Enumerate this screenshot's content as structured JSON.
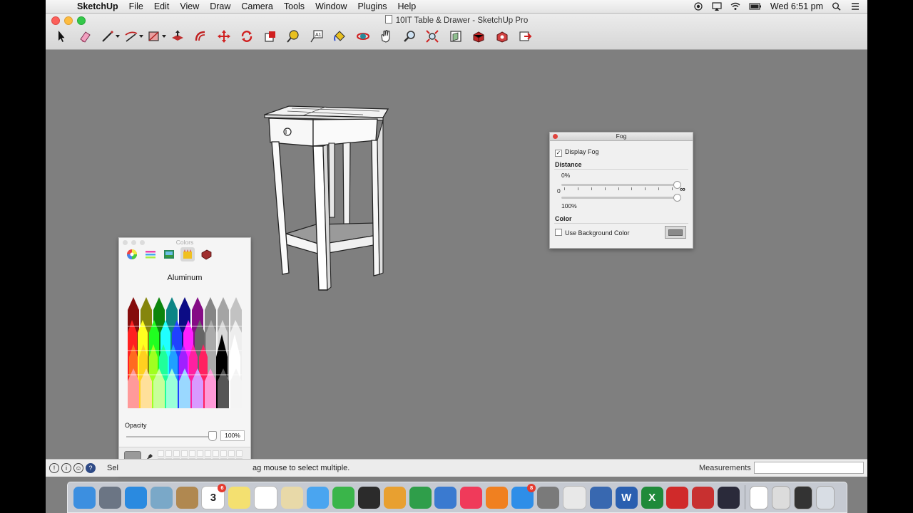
{
  "menubar": {
    "apple": "",
    "items": [
      "SketchUp",
      "File",
      "Edit",
      "View",
      "Draw",
      "Camera",
      "Tools",
      "Window",
      "Plugins",
      "Help"
    ],
    "clock": "Wed 6:51 pm"
  },
  "window": {
    "title": "10IT Table & Drawer - SketchUp Pro"
  },
  "toolbar": {
    "tools": [
      "select-tool",
      "eraser-tool",
      "line-tool",
      "arc-tool",
      "shapes-tool",
      "push-pull-tool",
      "offset-tool",
      "move-tool",
      "rotate-tool",
      "scale-tool",
      "tape-measure-tool",
      "text-tool",
      "paint-bucket-tool",
      "orbit-tool",
      "pan-tool",
      "zoom-tool",
      "zoom-extents-tool",
      "previous-view-tool",
      "warehouse-tool",
      "extension-warehouse-tool",
      "layout-tool"
    ]
  },
  "fog_panel": {
    "title": "Fog",
    "display_fog_label": "Display Fog",
    "display_fog_checked": true,
    "distance_label": "Distance",
    "start_value": "0%",
    "slider_min": "0",
    "slider_max": "∞",
    "end_value": "100%",
    "color_label": "Color",
    "use_bg_label": "Use Background Color",
    "use_bg_checked": false,
    "fog_color": "#8a8a8a"
  },
  "colors_panel": {
    "title": "Colors",
    "tabs": [
      "color-wheel",
      "color-sliders",
      "color-palettes",
      "image-palettes",
      "crayons"
    ],
    "selected_tab": "crayons",
    "crayon_name": "Aluminum",
    "opacity_label": "Opacity",
    "opacity_value": "100%",
    "opacity_fraction": 1.0,
    "current_color": "#9a9a9a"
  },
  "statusbar": {
    "text_left": "Sel",
    "text_right": "ag mouse to select multiple.",
    "measurements_label": "Measurements",
    "measurements_value": ""
  },
  "dock": {
    "apps": [
      {
        "name": "finder",
        "color": "#3c8fe0"
      },
      {
        "name": "launchpad",
        "color": "#6b7584"
      },
      {
        "name": "safari",
        "color": "#2a8ae0"
      },
      {
        "name": "preview",
        "color": "#7aa8c8"
      },
      {
        "name": "contacts",
        "color": "#b08850"
      },
      {
        "name": "calendar",
        "color": "#ffffff",
        "label": "3",
        "badge": "6"
      },
      {
        "name": "notes",
        "color": "#f4e070"
      },
      {
        "name": "reminders",
        "color": "#ffffff"
      },
      {
        "name": "preview-photos",
        "color": "#e8d9a8"
      },
      {
        "name": "messages",
        "color": "#4aa5f0"
      },
      {
        "name": "facetime",
        "color": "#3ab54a"
      },
      {
        "name": "photo-booth",
        "color": "#2b2b2b"
      },
      {
        "name": "pages",
        "color": "#e8a030"
      },
      {
        "name": "numbers",
        "color": "#2f9e4a"
      },
      {
        "name": "keynote",
        "color": "#3a7ad0"
      },
      {
        "name": "itunes",
        "color": "#f03a5a"
      },
      {
        "name": "ibooks",
        "color": "#f08020"
      },
      {
        "name": "app-store",
        "color": "#2e8ee8",
        "badge": "8"
      },
      {
        "name": "system-preferences",
        "color": "#7a7a7a"
      },
      {
        "name": "chrome",
        "color": "#e8e8e8"
      },
      {
        "name": "virtualbox",
        "color": "#3868b0"
      },
      {
        "name": "word",
        "color": "#2a5fb0",
        "label": "W"
      },
      {
        "name": "excel",
        "color": "#1f8a3a",
        "label": "X"
      },
      {
        "name": "sketchup",
        "color": "#d02a2a"
      },
      {
        "name": "layout",
        "color": "#c83030"
      },
      {
        "name": "quicktime",
        "color": "#2a2a3a"
      }
    ],
    "stacks": [
      "document",
      "screenshot",
      "terminal",
      "trash"
    ]
  }
}
